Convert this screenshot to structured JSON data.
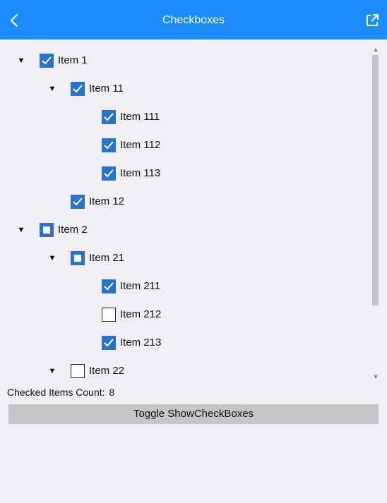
{
  "theme": {
    "accent": "#1a8cff",
    "checkbox": "#2b73c9"
  },
  "header": {
    "title": "Checkboxes",
    "back_icon": "chevron-left-icon",
    "popout_icon": "external-link-icon"
  },
  "tree": {
    "nodes": [
      {
        "label": "Item 1",
        "level": 0,
        "expanded": true,
        "state": "checked"
      },
      {
        "label": "Item 11",
        "level": 1,
        "expanded": true,
        "state": "checked"
      },
      {
        "label": "Item 111",
        "level": 2,
        "expanded": null,
        "state": "checked"
      },
      {
        "label": "Item 112",
        "level": 2,
        "expanded": null,
        "state": "checked"
      },
      {
        "label": "Item 113",
        "level": 2,
        "expanded": null,
        "state": "checked"
      },
      {
        "label": "Item 12",
        "level": 1,
        "expanded": null,
        "state": "checked"
      },
      {
        "label": "Item 2",
        "level": 0,
        "expanded": true,
        "state": "indeterminate"
      },
      {
        "label": "Item 21",
        "level": 1,
        "expanded": true,
        "state": "indeterminate"
      },
      {
        "label": "Item 211",
        "level": 2,
        "expanded": null,
        "state": "checked"
      },
      {
        "label": "Item 212",
        "level": 2,
        "expanded": null,
        "state": "unchecked"
      },
      {
        "label": "Item 213",
        "level": 2,
        "expanded": null,
        "state": "checked"
      },
      {
        "label": "Item 22",
        "level": 1,
        "expanded": true,
        "state": "unchecked"
      }
    ]
  },
  "footer": {
    "count_label": "Checked Items Count:",
    "count_value": "8",
    "toggle_button_label": "Toggle ShowCheckBoxes"
  }
}
